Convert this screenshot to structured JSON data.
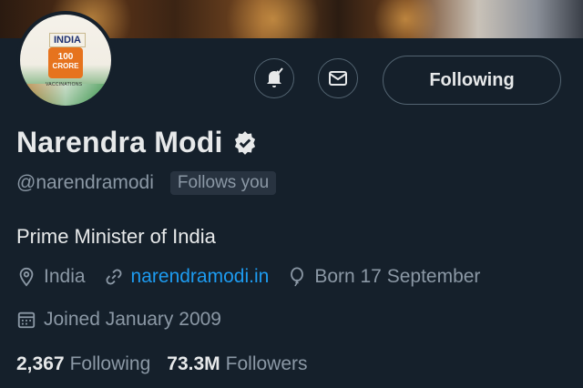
{
  "profile": {
    "name": "Narendra Modi",
    "handle": "@narendramodi",
    "follows_you": "Follows you",
    "bio": "Prime Minister of India",
    "location": "India",
    "website": "narendramodi.in",
    "born": "Born 17 September",
    "joined": "Joined January 2009",
    "verified_icon": "verified-badge-icon"
  },
  "avatar": {
    "top_text": "INDIA",
    "badge_number": "100",
    "badge_text": "CRORE",
    "sub_text": "VACCINATIONS"
  },
  "actions": {
    "notify_icon": "bell-icon",
    "message_icon": "mail-icon",
    "following_label": "Following"
  },
  "stats": {
    "following_count": "2,367",
    "following_label": "Following",
    "followers_count": "73.3M",
    "followers_label": "Followers"
  },
  "colors": {
    "background": "#15202b",
    "primary_text": "#e7e9ea",
    "secondary_text": "#8b98a5",
    "link": "#1d9bf0",
    "border": "#536471"
  }
}
